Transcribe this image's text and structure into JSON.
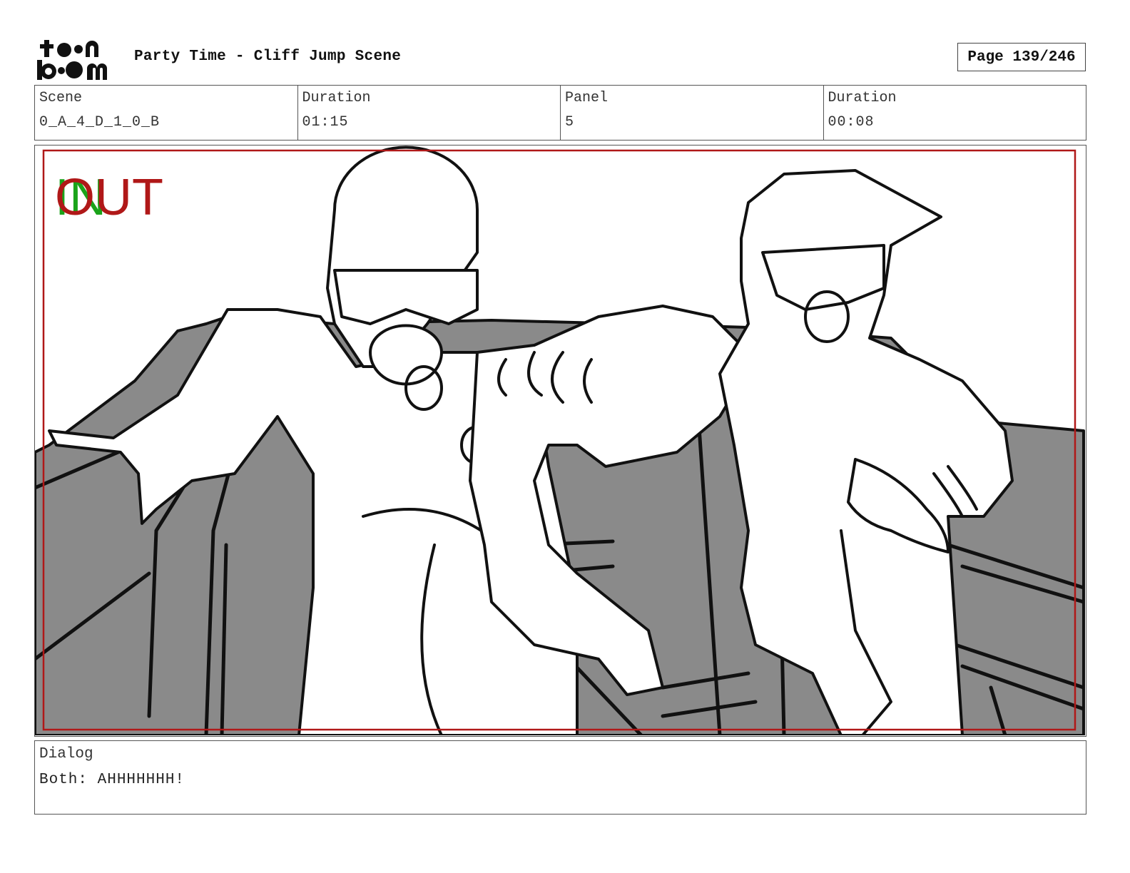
{
  "header": {
    "logo_text": "toon boom",
    "title": "Party Time - Cliff Jump Scene",
    "page": "Page 139/246"
  },
  "info": {
    "scene_label": "Scene",
    "scene_value": "0_A_4_D_1_0_B",
    "scene_duration_label": "Duration",
    "scene_duration_value": "01:15",
    "panel_label": "Panel",
    "panel_value": "5",
    "panel_duration_label": "Duration",
    "panel_duration_value": "00:08"
  },
  "panel": {
    "in_marker": "IN",
    "out_marker": "OUT",
    "in_color": "#1aa31a",
    "out_color": "#b01818",
    "safe_frame_color": "#b01818"
  },
  "dialog": {
    "label": "Dialog",
    "text": "Both: AHHHHHHH!"
  }
}
